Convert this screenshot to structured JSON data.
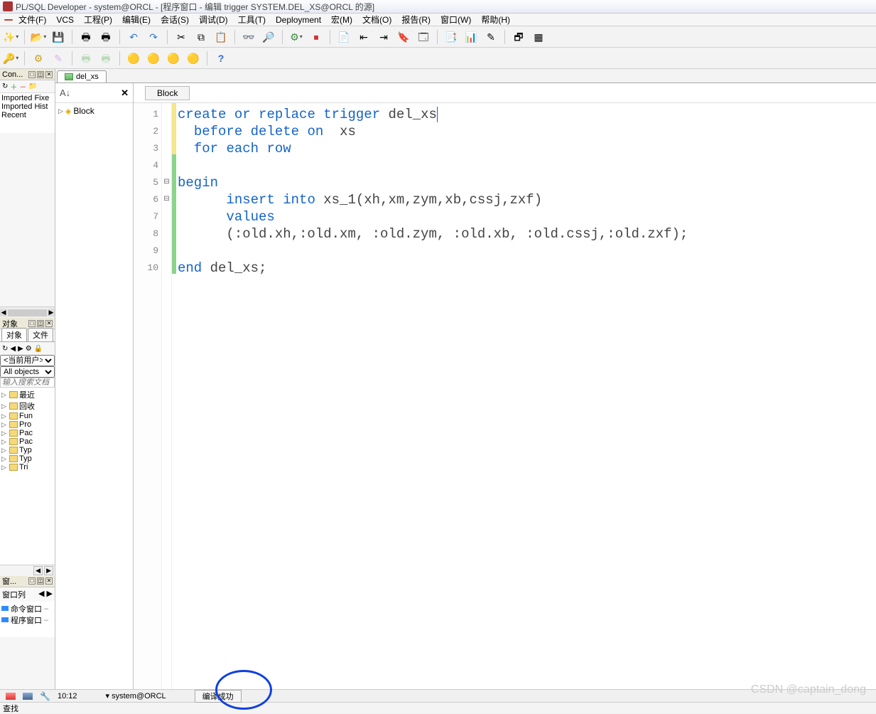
{
  "title": "PL/SQL Developer - system@ORCL - [程序窗口 - 编辑 trigger SYSTEM.DEL_XS@ORCL 的源]",
  "menus": [
    "文件(F)",
    "VCS",
    "工程(P)",
    "编辑(E)",
    "会话(S)",
    "调试(D)",
    "工具(T)",
    "Deployment",
    "宏(M)",
    "文档(O)",
    "报告(R)",
    "窗口(W)",
    "帮助(H)"
  ],
  "connections_panel": {
    "title": "Con...",
    "actions": [
      "□",
      "◫",
      "✕"
    ],
    "items": [
      "Imported Fixe",
      "Imported Hist",
      "Recent"
    ]
  },
  "objects_panel": {
    "title": "对象",
    "actions": [
      "□",
      "◫",
      "✕"
    ],
    "tabs": [
      "对象",
      "文件"
    ],
    "user_label": "<当前用户>",
    "type_filter": "All objects",
    "search_placeholder": "输入搜索文档",
    "tree": [
      "最近",
      "回收",
      "Fun",
      "Pro",
      "Pac",
      "Pac",
      "Typ",
      "Typ",
      "Tri"
    ]
  },
  "windows_panel": {
    "title": "窗...",
    "actions": [
      "□",
      "◫",
      "✕"
    ],
    "label": "窗口列",
    "items": [
      "命令窗口",
      "程序窗口"
    ]
  },
  "doc_tab": {
    "label": "del_xs"
  },
  "outline": {
    "root": "Block"
  },
  "block_button": "Block",
  "code": {
    "lines": [
      {
        "n": 1,
        "fold": "",
        "mark": "y",
        "html": "<span class='kw'>create</span> <span class='kw'>or</span> <span class='kw'>replace</span> <span class='kw'>trigger</span> del_xs<span class='cursor'></span>"
      },
      {
        "n": 2,
        "fold": "",
        "mark": "y",
        "html": "  <span class='kw'>before</span> <span class='kw'>delete</span> <span class='kw'>on</span>  xs"
      },
      {
        "n": 3,
        "fold": "",
        "mark": "y",
        "html": "  <span class='kw'>for</span> <span class='kw'>each</span> <span class='kw'>row</span>"
      },
      {
        "n": 4,
        "fold": "",
        "mark": "g",
        "html": ""
      },
      {
        "n": 5,
        "fold": "⊟",
        "mark": "g",
        "html": "<span class='kw'>begin</span>"
      },
      {
        "n": 6,
        "fold": "⊟",
        "mark": "g",
        "html": "      <span class='kw'>insert</span> <span class='kw'>into</span> xs_1(xh,xm,zym,xb,cssj,zxf)"
      },
      {
        "n": 7,
        "fold": "",
        "mark": "g",
        "html": "      <span class='kw'>values</span>"
      },
      {
        "n": 8,
        "fold": "",
        "mark": "g",
        "html": "      (:old.xh,:old.xm, :old.zym, :old.xb, :old.cssj,:old.zxf);"
      },
      {
        "n": 9,
        "fold": "",
        "mark": "g",
        "html": ""
      },
      {
        "n": 10,
        "fold": "",
        "mark": "g",
        "html": "<span class='kw'>end</span> del_xs;"
      }
    ]
  },
  "status": {
    "time": "10:12",
    "connection": "system@ORCL",
    "compile": "编译成功"
  },
  "global_status": "查找",
  "watermark": "CSDN @captain_dong"
}
